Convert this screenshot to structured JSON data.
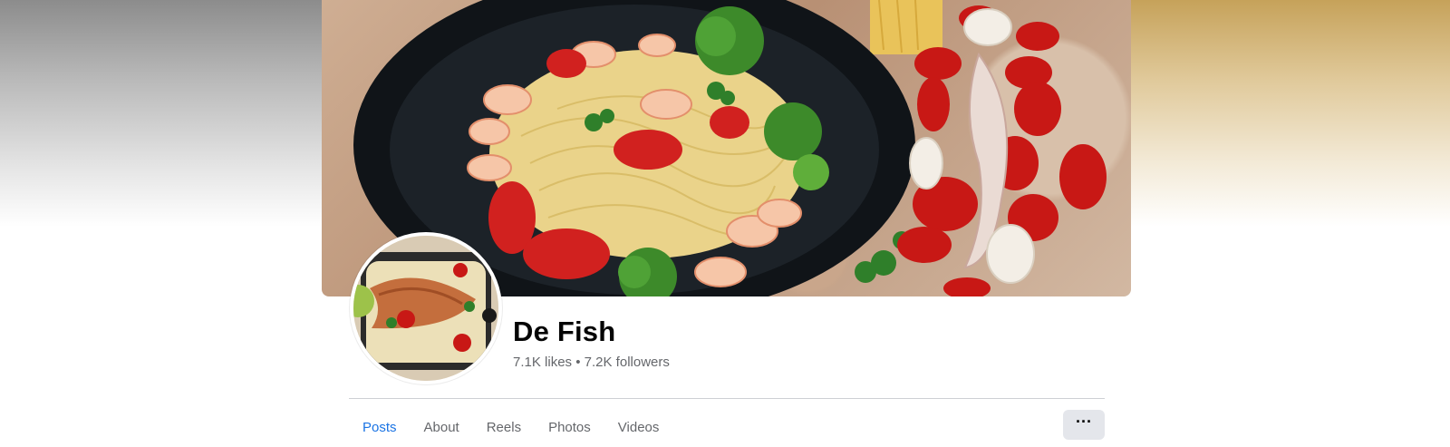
{
  "page": {
    "name": "De Fish",
    "likes": "7.1K likes",
    "separator": "•",
    "followers": "7.2K followers"
  },
  "tabs": [
    {
      "label": "Posts",
      "active": true
    },
    {
      "label": "About",
      "active": false
    },
    {
      "label": "Reels",
      "active": false
    },
    {
      "label": "Photos",
      "active": false
    },
    {
      "label": "Videos",
      "active": false
    }
  ],
  "more_button": {
    "label": "···",
    "icon": "more-options-icon"
  },
  "images": {
    "cover": "cover-photo-shrimp-pasta",
    "avatar": "profile-photo-salmon-dish"
  },
  "colors": {
    "active_tab": "#1b74e4",
    "muted_text": "#65676b",
    "button_bg": "#e4e6eb",
    "divider": "#ced0d4"
  }
}
